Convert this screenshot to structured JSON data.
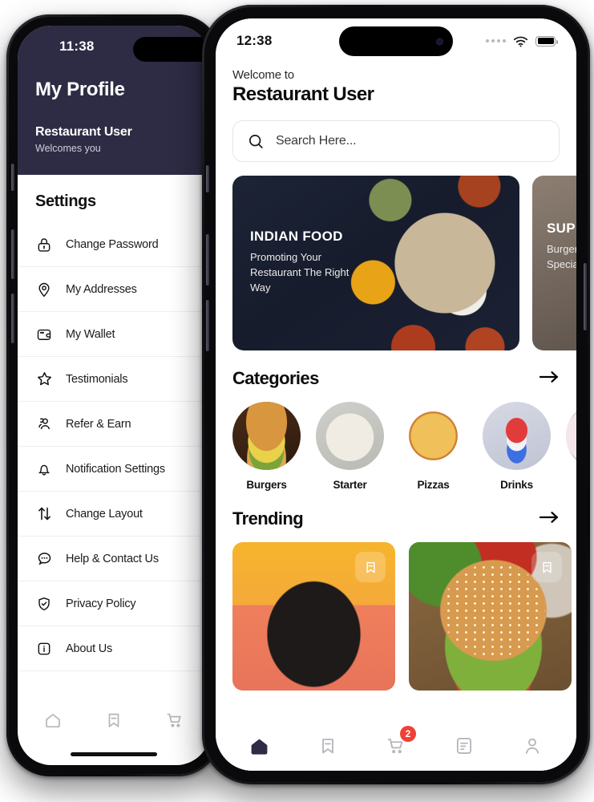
{
  "left_phone": {
    "statusbar": {
      "time": "11:38"
    },
    "header": {
      "title": "My Profile",
      "user_name": "Restaurant User",
      "user_sub": "Welcomes you"
    },
    "section_title": "Settings",
    "menu_items": [
      {
        "label": "Change Password",
        "icon": "lock-icon"
      },
      {
        "label": "My Addresses",
        "icon": "location-pin-icon"
      },
      {
        "label": "My Wallet",
        "icon": "wallet-icon"
      },
      {
        "label": "Testimonials",
        "icon": "star-icon"
      },
      {
        "label": "Refer & Earn",
        "icon": "users-icon"
      },
      {
        "label": "Notification Settings",
        "icon": "bell-icon"
      },
      {
        "label": "Change Layout",
        "icon": "arrows-up-down-icon"
      },
      {
        "label": "Help & Contact Us",
        "icon": "chat-bubble-icon"
      },
      {
        "label": "Privacy Policy",
        "icon": "shield-check-icon"
      },
      {
        "label": "About Us",
        "icon": "info-icon"
      }
    ],
    "tabbar": [
      {
        "icon": "home-icon",
        "active": false
      },
      {
        "icon": "bookmark-icon",
        "active": false
      },
      {
        "icon": "cart-icon",
        "active": false
      }
    ]
  },
  "right_phone": {
    "statusbar": {
      "time": "12:38",
      "signal_icon": "signal-dots-icon",
      "wifi_icon": "wifi-icon",
      "battery_icon": "battery-icon"
    },
    "header": {
      "welcome": "Welcome to",
      "name": "Restaurant User"
    },
    "search": {
      "placeholder": "Search Here...",
      "icon": "search-icon"
    },
    "banners": [
      {
        "heading": "INDIAN FOOD",
        "text": "Promoting Your Restaurant The Right Way",
        "image": "indian-thali-photo"
      },
      {
        "heading": "SUPER",
        "text": "Burger Special",
        "image": "burger-photo"
      }
    ],
    "categories_section": {
      "title": "Categories",
      "arrow_icon": "arrow-right-icon"
    },
    "categories": [
      {
        "label": "Burgers",
        "image": "burger-photo"
      },
      {
        "label": "Starter",
        "image": "pasta-photo"
      },
      {
        "label": "Pizzas",
        "image": "pizza-photo"
      },
      {
        "label": "Drinks",
        "image": "drink-photo"
      },
      {
        "label": "",
        "image": "partial-photo"
      }
    ],
    "trending_section": {
      "title": "Trending",
      "arrow_icon": "arrow-right-icon"
    },
    "trending": [
      {
        "image": "chocolate-cake-photo",
        "bookmark_icon": "bookmark-icon"
      },
      {
        "image": "burger-photo",
        "bookmark_icon": "bookmark-icon"
      }
    ],
    "tabbar": [
      {
        "icon": "home-icon",
        "active": true,
        "badge": ""
      },
      {
        "icon": "bookmark-icon",
        "active": false,
        "badge": ""
      },
      {
        "icon": "cart-icon",
        "active": false,
        "badge": "2"
      },
      {
        "icon": "orders-icon",
        "active": false,
        "badge": ""
      },
      {
        "icon": "profile-icon",
        "active": false,
        "badge": ""
      }
    ]
  },
  "colors": {
    "header_purple": "#2e2c45",
    "badge_red": "#ef4136",
    "active_nav": "#2e2c45",
    "inactive_nav": "#b4b6bb"
  }
}
